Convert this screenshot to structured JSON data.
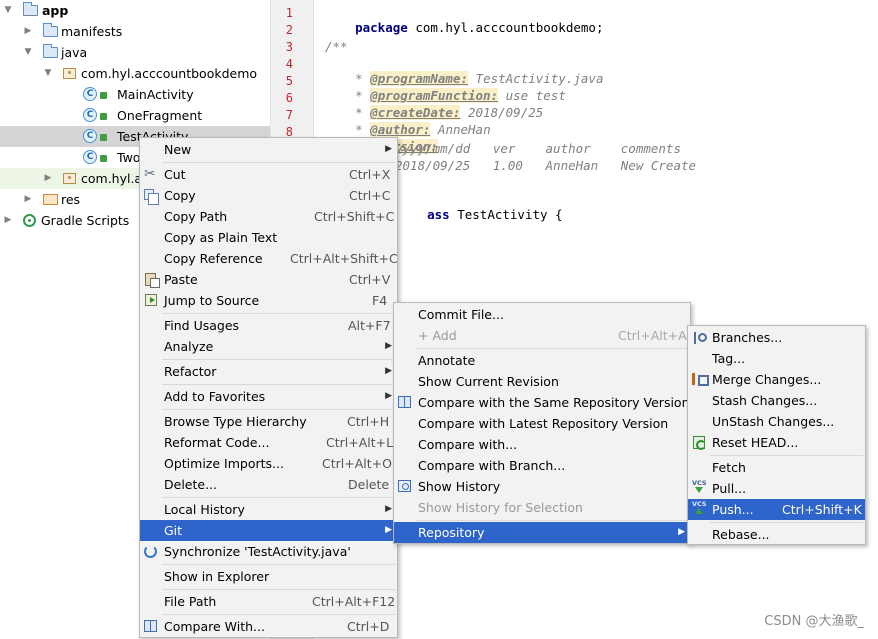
{
  "tree": {
    "items": [
      {
        "label": "app",
        "icon": "folder-app-icon"
      },
      {
        "label": "manifests",
        "icon": "folder-icon"
      },
      {
        "label": "java",
        "icon": "folder-icon"
      },
      {
        "label": "com.hyl.acccountbookdemo",
        "icon": "package-icon"
      },
      {
        "label": "MainActivity",
        "icon": "class-icon"
      },
      {
        "label": "OneFragment",
        "icon": "class-icon"
      },
      {
        "label": "TestActivity",
        "icon": "class-icon"
      },
      {
        "label": "Two",
        "icon": "class-icon"
      },
      {
        "label": "com.hyl.ac",
        "icon": "package-icon"
      },
      {
        "label": "res",
        "icon": "folder-res-icon"
      },
      {
        "label": "Gradle Scripts",
        "icon": "gradle-icon"
      }
    ]
  },
  "editor": {
    "line_numbers": [
      "1",
      "2",
      "3",
      "4",
      "5",
      "6",
      "7",
      "8"
    ],
    "lines": {
      "l1_kw": "package",
      "l1_rest": " com.hyl.acccountbookdemo;",
      "l3": "/**",
      "l4_tag": "@programName:",
      "l4_val": " TestActivity.java",
      "l5_tag": "@programFunction:",
      "l5_val": " use test",
      "l6_tag": "@createDate:",
      "l6_val": " 2018/09/25",
      "l7_tag": "@author:",
      "l7_val": " AnneHan",
      "l8_tag": "@version:",
      "l9": "yyyy/mm/dd   ver    author    comments",
      "l10": "2018/09/25   1.00   AnneHan   New Create",
      "l12_kw": "ass",
      "l12_rest": " TestActivity {",
      "star": "*"
    }
  },
  "context_menu": {
    "items": [
      {
        "label": "New",
        "shortcut": "",
        "submenu": true
      },
      {
        "label": "Cut",
        "shortcut": "Ctrl+X",
        "icon": "cut-icon"
      },
      {
        "label": "Copy",
        "shortcut": "Ctrl+C",
        "icon": "copy-icon"
      },
      {
        "label": "Copy Path",
        "shortcut": "Ctrl+Shift+C"
      },
      {
        "label": "Copy as Plain Text",
        "shortcut": ""
      },
      {
        "label": "Copy Reference",
        "shortcut": "Ctrl+Alt+Shift+C"
      },
      {
        "label": "Paste",
        "shortcut": "Ctrl+V",
        "icon": "paste-icon"
      },
      {
        "label": "Jump to Source",
        "shortcut": "F4",
        "icon": "jump-to-source-icon"
      },
      {
        "label": "Find Usages",
        "shortcut": "Alt+F7"
      },
      {
        "label": "Analyze",
        "shortcut": "",
        "submenu": true
      },
      {
        "label": "Refactor",
        "shortcut": "",
        "submenu": true
      },
      {
        "label": "Add to Favorites",
        "shortcut": "",
        "submenu": true
      },
      {
        "label": "Browse Type Hierarchy",
        "shortcut": "Ctrl+H"
      },
      {
        "label": "Reformat Code...",
        "shortcut": "Ctrl+Alt+L"
      },
      {
        "label": "Optimize Imports...",
        "shortcut": "Ctrl+Alt+O"
      },
      {
        "label": "Delete...",
        "shortcut": "Delete"
      },
      {
        "label": "Local History",
        "shortcut": "",
        "submenu": true
      },
      {
        "label": "Git",
        "shortcut": "",
        "submenu": true
      },
      {
        "label": "Synchronize 'TestActivity.java'",
        "shortcut": "",
        "icon": "synchronize-icon"
      },
      {
        "label": "Show in Explorer",
        "shortcut": ""
      },
      {
        "label": "File Path",
        "shortcut": "Ctrl+Alt+F12"
      },
      {
        "label": "Compare With...",
        "shortcut": "Ctrl+D",
        "icon": "compare-icon"
      }
    ]
  },
  "git_menu": {
    "items": [
      {
        "label": "Commit File...",
        "shortcut": ""
      },
      {
        "label": "+ Add",
        "shortcut": "Ctrl+Alt+A"
      },
      {
        "label": "Annotate",
        "shortcut": ""
      },
      {
        "label": "Show Current Revision",
        "shortcut": ""
      },
      {
        "label": "Compare with the Same Repository Version",
        "shortcut": "",
        "icon": "compare-icon"
      },
      {
        "label": "Compare with Latest Repository Version",
        "shortcut": ""
      },
      {
        "label": "Compare with...",
        "shortcut": ""
      },
      {
        "label": "Compare with Branch...",
        "shortcut": ""
      },
      {
        "label": "Show History",
        "shortcut": "",
        "icon": "history-icon"
      },
      {
        "label": "Show History for Selection",
        "shortcut": ""
      },
      {
        "label": "Repository",
        "shortcut": "",
        "submenu": true
      }
    ]
  },
  "repo_menu": {
    "items": [
      {
        "label": "Branches...",
        "shortcut": "",
        "icon": "branch-icon"
      },
      {
        "label": "Tag...",
        "shortcut": ""
      },
      {
        "label": "Merge Changes...",
        "shortcut": "",
        "icon": "merge-icon"
      },
      {
        "label": "Stash Changes...",
        "shortcut": ""
      },
      {
        "label": "UnStash Changes...",
        "shortcut": ""
      },
      {
        "label": "Reset HEAD...",
        "shortcut": "",
        "icon": "reset-icon"
      },
      {
        "label": "Fetch",
        "shortcut": ""
      },
      {
        "label": "Pull...",
        "shortcut": "",
        "icon": "vcs-pull-icon"
      },
      {
        "label": "Push...",
        "shortcut": "Ctrl+Shift+K",
        "icon": "vcs-push-icon"
      },
      {
        "label": "Rebase...",
        "shortcut": ""
      }
    ]
  },
  "icon_glyphs": {
    "vcs": "VCS",
    "class": "C",
    "cut": "✂"
  },
  "watermark": "CSDN @大渔歌_",
  "colors": {
    "highlight": "#2f65ca",
    "selected_tree": "#d5d5d5",
    "keyword": "#000080",
    "line_number": "#c0282e"
  }
}
